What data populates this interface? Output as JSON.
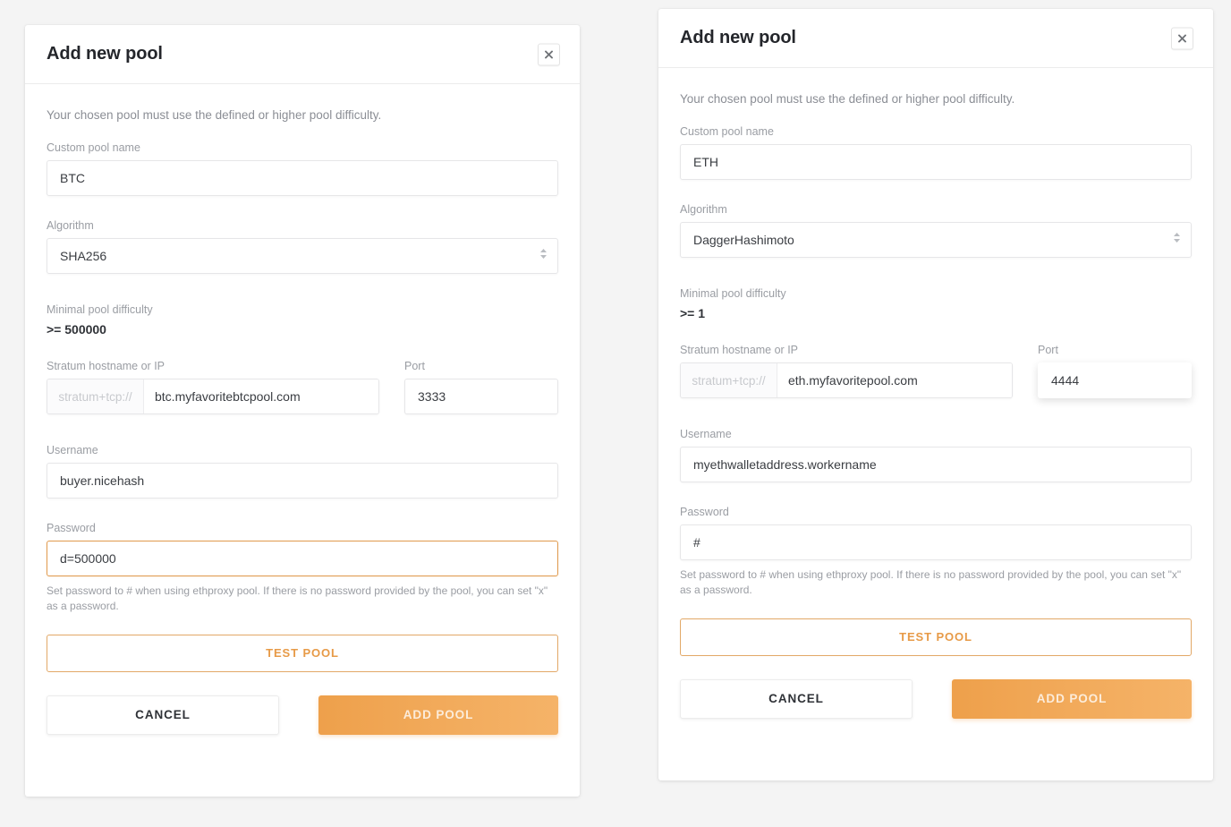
{
  "page": {
    "background_color": "#f4f4f4",
    "accent_color": "#e79a47",
    "add_button_gradient_from": "#eea04b",
    "add_button_gradient_to": "#f5b368"
  },
  "panels": [
    {
      "title": "Add new pool",
      "close_icon": "close-icon",
      "intro": "Your chosen pool must use the defined or higher pool difficulty.",
      "pool_name": {
        "label": "Custom pool name",
        "value": "BTC",
        "placeholder": ""
      },
      "algorithm": {
        "label": "Algorithm",
        "value": "SHA256",
        "spinner_icon": "chevron-updown-icon"
      },
      "difficulty": {
        "label": "Minimal pool difficulty",
        "value": ">= 500000"
      },
      "stratum": {
        "label": "Stratum hostname or IP",
        "prefix": "stratum+tcp://",
        "value": "btc.myfavoritebtcpool.com",
        "placeholder": ""
      },
      "port": {
        "label": "Port",
        "value": "3333",
        "placeholder": "",
        "state": "normal"
      },
      "username": {
        "label": "Username",
        "value": "buyer.nicehash",
        "placeholder": ""
      },
      "password": {
        "label": "Password",
        "value": "d=500000",
        "placeholder": "",
        "state": "focused"
      },
      "hint": "Set password to # when using ethproxy pool. If there is no password provided by the pool, you can set \"x\" as a password.",
      "test_button": "TEST POOL",
      "cancel_button": "CANCEL",
      "add_button": "ADD POOL"
    },
    {
      "title": "Add new pool",
      "close_icon": "close-icon",
      "intro": "Your chosen pool must use the defined or higher pool difficulty.",
      "pool_name": {
        "label": "Custom pool name",
        "value": "ETH",
        "placeholder": ""
      },
      "algorithm": {
        "label": "Algorithm",
        "value": "DaggerHashimoto",
        "spinner_icon": "chevron-updown-icon"
      },
      "difficulty": {
        "label": "Minimal pool difficulty",
        "value": ">= 1"
      },
      "stratum": {
        "label": "Stratum hostname or IP",
        "prefix": "stratum+tcp://",
        "value": "eth.myfavoritepool.com",
        "placeholder": ""
      },
      "port": {
        "label": "Port",
        "value": "4444",
        "placeholder": "",
        "state": "elevated"
      },
      "username": {
        "label": "Username",
        "value": "myethwalletaddress.workername",
        "placeholder": ""
      },
      "password": {
        "label": "Password",
        "value": "#",
        "placeholder": "",
        "state": "normal"
      },
      "hint": "Set password to # when using ethproxy pool. If there is no password provided by the pool, you can set \"x\" as a password.",
      "test_button": "TEST POOL",
      "cancel_button": "CANCEL",
      "add_button": "ADD POOL"
    }
  ]
}
